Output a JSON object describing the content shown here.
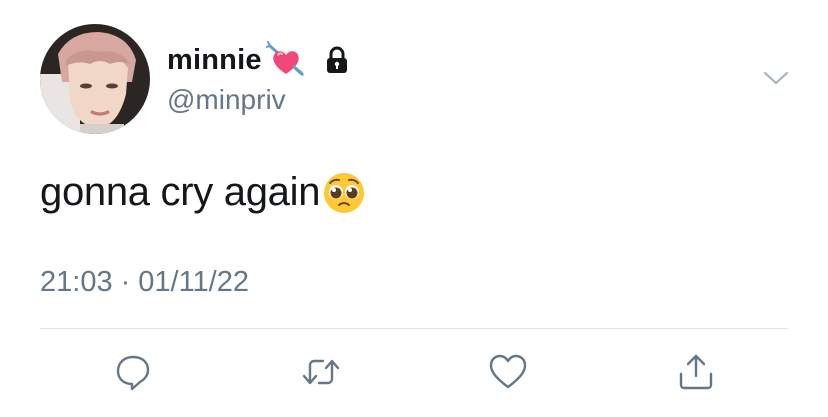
{
  "user": {
    "display_name": "minnie",
    "handle": "@minpriv",
    "name_emoji": "heart-with-arrow-emoji",
    "protected_icon": "lock-icon"
  },
  "tweet": {
    "text": "gonna cry again",
    "trailing_emoji": "pleading-face-emoji"
  },
  "meta": {
    "time": "21:03",
    "separator": "·",
    "date": "01/11/22"
  },
  "actions": [
    "reply-icon",
    "retweet-icon",
    "like-icon",
    "share-icon"
  ],
  "colors": {
    "text_primary": "#14171a",
    "text_secondary": "#657786",
    "icon_gray": "#657786",
    "divider": "#dfe5ea"
  }
}
